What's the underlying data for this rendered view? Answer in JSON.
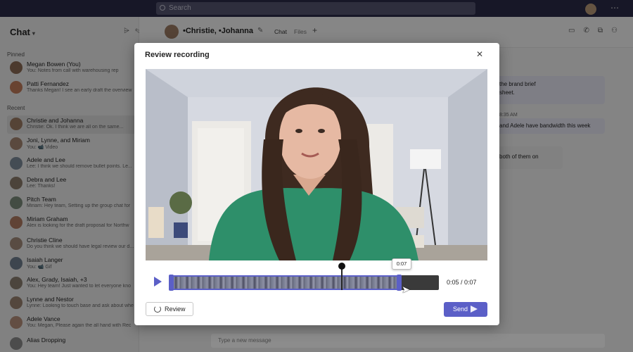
{
  "topbar": {
    "search_placeholder": "Search"
  },
  "sidebar": {
    "title": "Chat",
    "sections": {
      "pinned": "Pinned",
      "recent": "Recent"
    },
    "items": [
      {
        "name": "Megan Bowen (You)",
        "preview": "You: Notes from call with warehousing rep",
        "color": "#8a6b55"
      },
      {
        "name": "Patti Fernandez",
        "preview": "Thanks Megan! I see an early draft the overview",
        "color": "#c07a5a"
      },
      {
        "name": "Christie and Johanna",
        "preview": "Christie: Ok. I think we are all on the same...",
        "color": "#9b7a63",
        "active": true
      },
      {
        "name": "Joni, Lynne, and Miriam",
        "preview": "You: 📹 Video",
        "color": "#a58672"
      },
      {
        "name": "Adele and Lee",
        "preview": "Lee: I think we should remove bullet points. Le...",
        "color": "#7c8a9a"
      },
      {
        "name": "Debra and Lee",
        "preview": "Lee: Thanks!",
        "color": "#8b7b6a"
      },
      {
        "name": "Pitch Team",
        "preview": "Miriam: Hey team, Setting up the group chat for",
        "color": "#7a8a7a"
      },
      {
        "name": "Miriam Graham",
        "preview": "Alex is looking for the draft proposal for Northw",
        "color": "#b07a62"
      },
      {
        "name": "Christie Cline",
        "preview": "Do you think we should have legal review our d...",
        "color": "#a38a7a"
      },
      {
        "name": "Isaiah Langer",
        "preview": "You: 📹 Gif",
        "color": "#6f7f8f"
      },
      {
        "name": "Alex, Grady, Isaiah, +3",
        "preview": "You: Hey team! Just wanted to let everyone kno",
        "color": "#8a7f6f"
      },
      {
        "name": "Lynne and Nestor",
        "preview": "Lynne: Looking to touch base and ask about whe",
        "color": "#9a8270"
      },
      {
        "name": "Adele Vance",
        "preview": "You: Megan, Please again the all hand with Rec",
        "color": "#b58f7a"
      },
      {
        "name": "Alias Dropping",
        "preview": "",
        "color": "#8a8a8a"
      }
    ]
  },
  "header": {
    "title": "•Christie, •Johanna",
    "tabs": [
      "Chat",
      "Files"
    ]
  },
  "messages": {
    "line1": "the brand brief",
    "line2": "sheet.",
    "time": "8:35 AM",
    "line3": "and Adele have bandwidth this week",
    "line4": "both of them on"
  },
  "compose": {
    "placeholder": "Type a new message"
  },
  "modal": {
    "title": "Review recording",
    "video_alt": "Recorded video of a woman in a green shirt in a room",
    "timeline": {
      "selection_end_fraction": 0.86,
      "playhead_fraction": 0.64,
      "tooltip": "0:07",
      "timecode": "0:05 / 0:07"
    },
    "review_label": "Review",
    "send_label": "Send"
  },
  "colors": {
    "accent": "#5b5fc7",
    "topbar": "#2a2a48"
  }
}
